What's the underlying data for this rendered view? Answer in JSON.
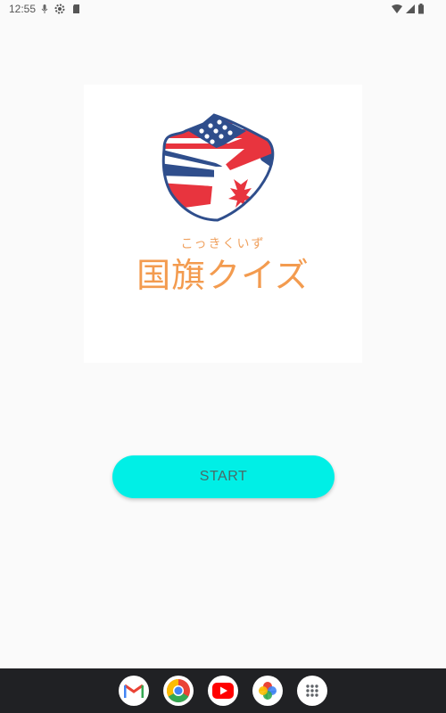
{
  "status_bar": {
    "time": "12:55",
    "icons": [
      "mic-icon",
      "settings-icon",
      "sd-card-icon",
      "wifi-icon",
      "signal-icon",
      "battery-icon"
    ]
  },
  "logo": {
    "furigana": "こっきくいず",
    "title": "国旗クイズ",
    "colors": {
      "text": "#f39b4f",
      "navy": "#2f4e8c",
      "red": "#e8343e"
    }
  },
  "start_button": {
    "label": "START",
    "color": "#00efe6"
  },
  "dock": {
    "apps": [
      "gmail-icon",
      "chrome-icon",
      "youtube-icon",
      "photos-icon",
      "app-drawer-icon"
    ]
  }
}
